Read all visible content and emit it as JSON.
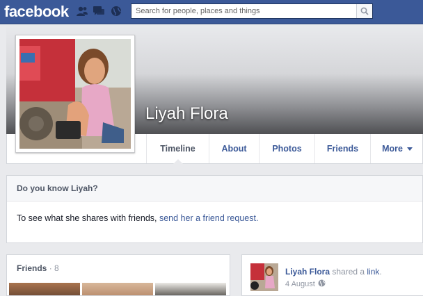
{
  "header": {
    "logo_text": "facebook",
    "search_placeholder": "Search for people, places and things",
    "jewels": [
      "friend-requests-icon",
      "messages-icon",
      "notifications-globe-icon"
    ],
    "brand_color": "#3b5998"
  },
  "profile": {
    "name": "Liyah Flora"
  },
  "tabs": [
    {
      "label": "Timeline",
      "active": true
    },
    {
      "label": "About"
    },
    {
      "label": "Photos"
    },
    {
      "label": "Friends"
    },
    {
      "label": "More"
    }
  ],
  "know_box": {
    "title": "Do you know Liyah?",
    "body_prefix": "To see what she shares with friends, ",
    "link_text": "send her a friend request."
  },
  "friends_box": {
    "title": "Friends",
    "count": "· 8"
  },
  "post": {
    "author": "Liyah Flora",
    "action": " shared a ",
    "link_word": "link",
    "period": ".",
    "date": "4 August"
  }
}
